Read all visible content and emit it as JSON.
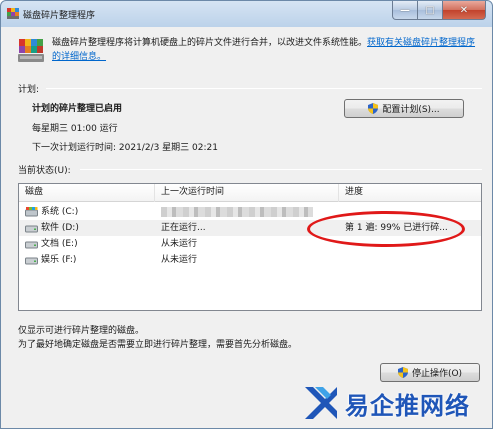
{
  "window": {
    "title": "磁盘碎片整理程序",
    "controls": {
      "minimize": "—",
      "maximize": "□",
      "close": "✕"
    }
  },
  "intro": {
    "text": "磁盘碎片整理程序将计算机硬盘上的碎片文件进行合并，以改进文件系统性能。",
    "link": "获取有关磁盘碎片整理程序的详细信息。"
  },
  "schedule": {
    "section_label": "计划:",
    "heading": "计划的碎片整理已启用",
    "runs": "每星期三 01:00 运行",
    "next_run": "下一次计划运行时间: 2021/2/3 星期三 02:21",
    "configure_button": "配置计划(S)..."
  },
  "status": {
    "section_label": "当前状态(U):",
    "columns": [
      "磁盘",
      "上一次运行时间",
      "进度"
    ],
    "rows": [
      {
        "disk": "系统 (C:)",
        "last_run": "",
        "progress": ""
      },
      {
        "disk": "软件 (D:)",
        "last_run": "正在运行...",
        "progress": "第 1 遍: 99% 已进行碎..."
      },
      {
        "disk": "文档 (E:)",
        "last_run": "从未运行",
        "progress": ""
      },
      {
        "disk": "娱乐 (F:)",
        "last_run": "从未运行",
        "progress": ""
      }
    ]
  },
  "footer": {
    "line1": "仅显示可进行碎片整理的磁盘。",
    "line2": "为了最好地确定磁盘是否需要立即进行碎片整理，需要首先分析磁盘。",
    "stop_button": "停止操作(O)"
  },
  "watermark": {
    "text": "易企推网络"
  },
  "colors": {
    "link": "#0066cc",
    "highlight": "#e01919",
    "watermark": "#1f56b8"
  }
}
